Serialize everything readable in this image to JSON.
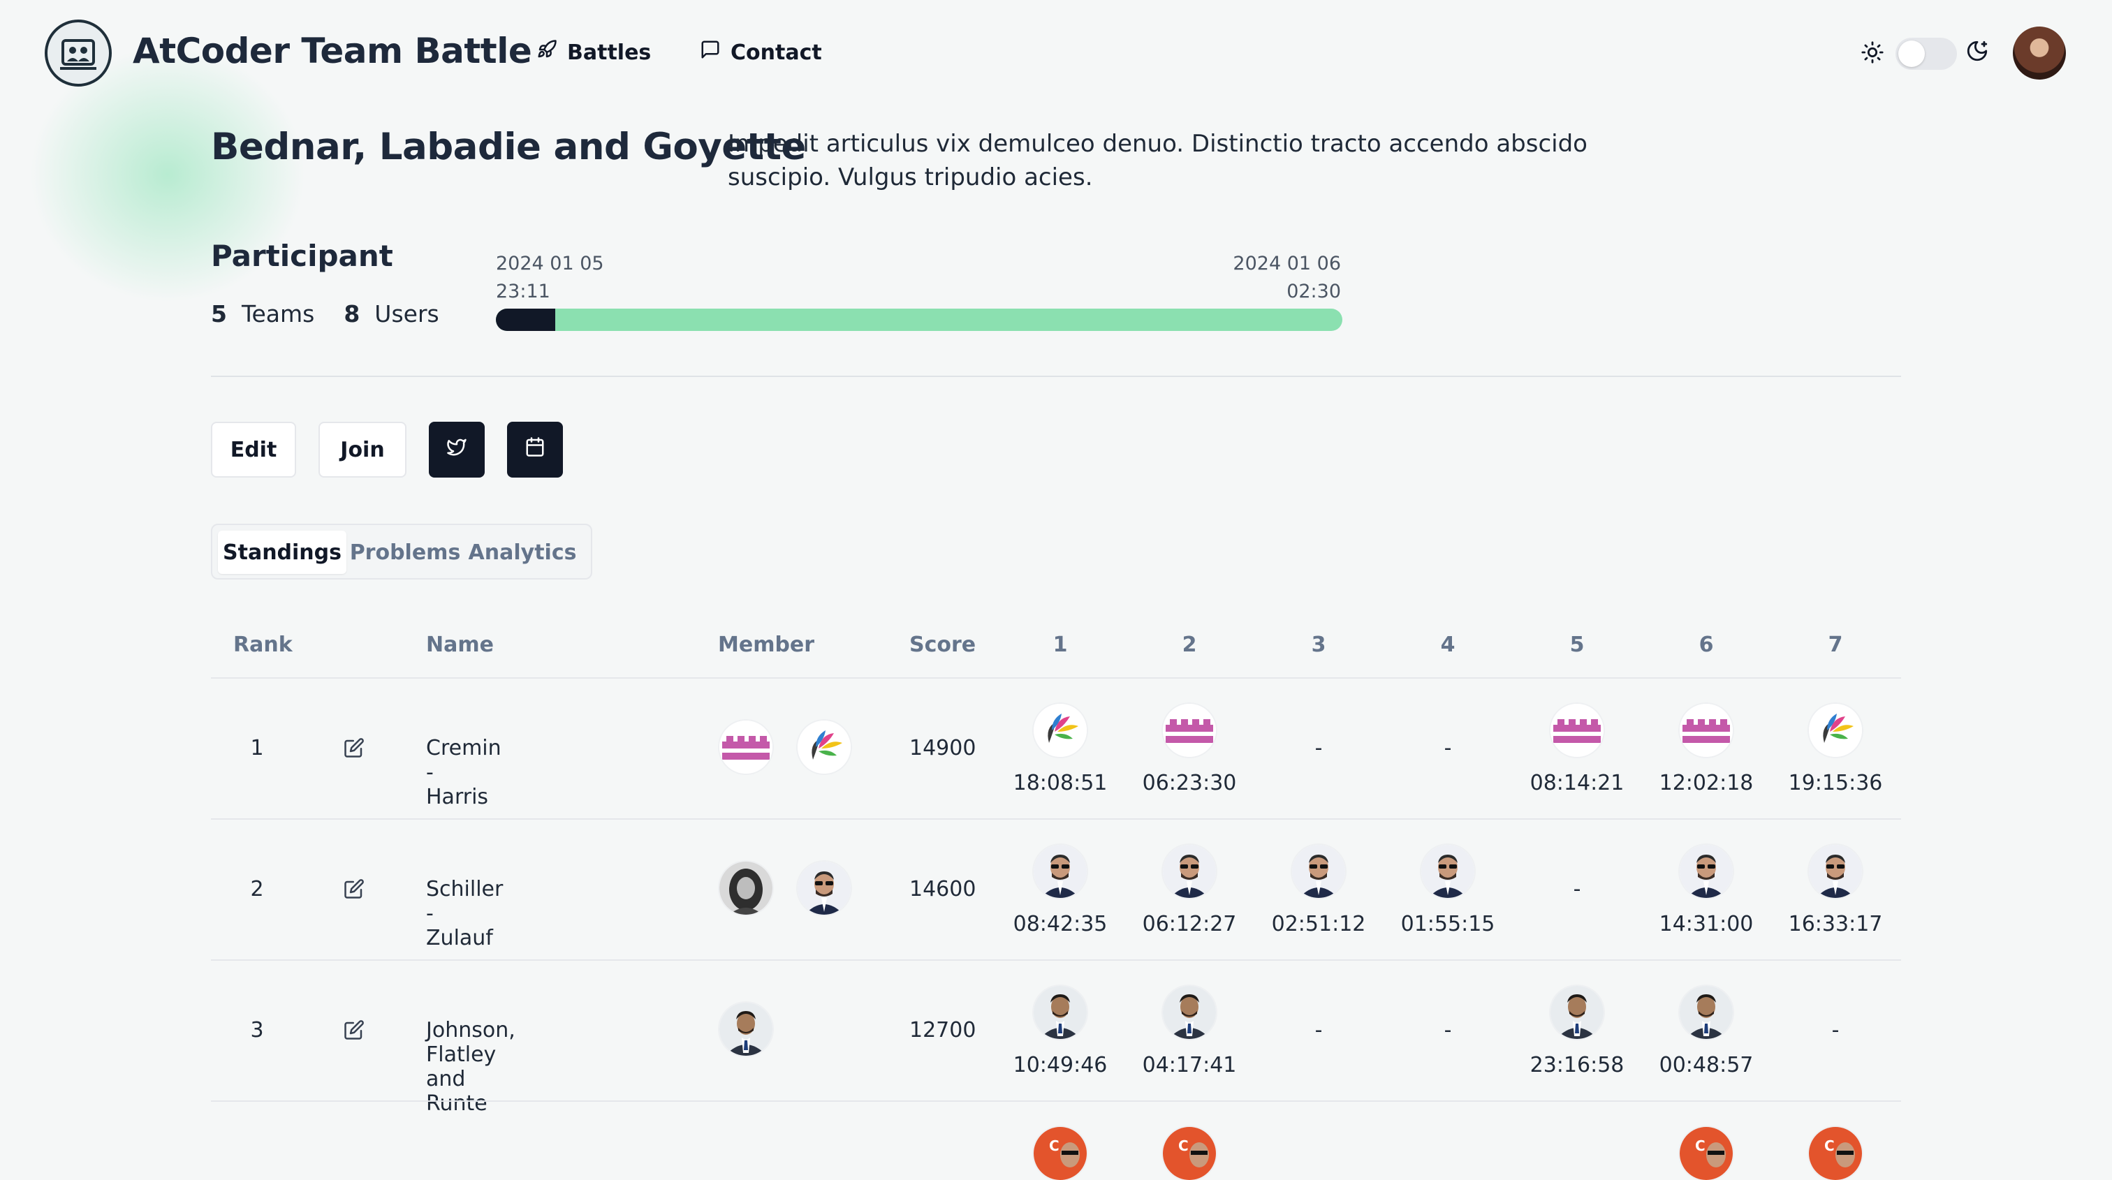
{
  "header": {
    "brand": "AtCoder Team Battle",
    "nav": [
      {
        "label": "Battles",
        "icon": "rocket-icon"
      },
      {
        "label": "Contact",
        "icon": "message-icon"
      }
    ]
  },
  "battle": {
    "title": "Bednar, Labadie and Goyette",
    "description": "Impedit articulus vix demulceo denuo. Distinctio tracto accendo abscido suscipio. Vulgus tripudio acies."
  },
  "participant": {
    "title": "Participant",
    "teams_count": "5",
    "teams_label": "Teams",
    "users_count": "8",
    "users_label": "Users"
  },
  "timeline": {
    "start_date": "2024 01 05",
    "start_time": "23:11",
    "end_date": "2024 01 06",
    "end_time": "02:30",
    "elapsed_fraction": 0.07
  },
  "actions": {
    "edit_label": "Edit",
    "join_label": "Join"
  },
  "tabs": [
    "Standings",
    "Problems",
    "Analytics"
  ],
  "table": {
    "headers": [
      "Rank",
      "Name",
      "Member",
      "Score",
      "1",
      "2",
      "3",
      "4",
      "5",
      "6",
      "7"
    ],
    "rows": [
      {
        "rank": "1",
        "name": "Cremin - Harris",
        "score": "14900",
        "members": [
          "pixel-avatar",
          "petal-avatar"
        ],
        "problems": [
          {
            "avatar": "petal-avatar",
            "time": "18:08:51"
          },
          {
            "avatar": "pixel-avatar",
            "time": "06:23:30"
          },
          {
            "avatar": null,
            "time": "-"
          },
          {
            "avatar": null,
            "time": "-"
          },
          {
            "avatar": "pixel-avatar",
            "time": "08:14:21"
          },
          {
            "avatar": "pixel-avatar",
            "time": "12:02:18"
          },
          {
            "avatar": "petal-avatar",
            "time": "19:15:36"
          }
        ]
      },
      {
        "rank": "2",
        "name": "Schiller - Zulauf",
        "score": "14600",
        "members": [
          "woman-avatar",
          "sunglasses-man-avatar"
        ],
        "problems": [
          {
            "avatar": "sunglasses-man-avatar",
            "time": "08:42:35"
          },
          {
            "avatar": "sunglasses-man-avatar",
            "time": "06:12:27"
          },
          {
            "avatar": "sunglasses-man-avatar",
            "time": "02:51:12"
          },
          {
            "avatar": "sunglasses-man-avatar",
            "time": "01:55:15"
          },
          {
            "avatar": null,
            "time": "-"
          },
          {
            "avatar": "sunglasses-man-avatar",
            "time": "14:31:00"
          },
          {
            "avatar": "sunglasses-man-avatar",
            "time": "16:33:17"
          }
        ]
      },
      {
        "rank": "3",
        "name": "Johnson, Flatley and Runte",
        "score": "12700",
        "members": [
          "suit-man-avatar"
        ],
        "problems": [
          {
            "avatar": "suit-man-avatar",
            "time": "10:49:46"
          },
          {
            "avatar": "suit-man-avatar",
            "time": "04:17:41"
          },
          {
            "avatar": null,
            "time": "-"
          },
          {
            "avatar": null,
            "time": "-"
          },
          {
            "avatar": "suit-man-avatar",
            "time": "23:16:58"
          },
          {
            "avatar": "suit-man-avatar",
            "time": "00:48:57"
          },
          {
            "avatar": null,
            "time": "-"
          }
        ]
      },
      {
        "rank": "",
        "name": "",
        "score": "",
        "members": [],
        "problems": [
          {
            "avatar": "orange-c-avatar",
            "time": ""
          },
          {
            "avatar": "orange-c-avatar",
            "time": ""
          },
          {
            "avatar": null,
            "time": ""
          },
          {
            "avatar": null,
            "time": ""
          },
          {
            "avatar": null,
            "time": ""
          },
          {
            "avatar": "orange-c-avatar",
            "time": ""
          },
          {
            "avatar": "orange-c-avatar",
            "time": ""
          }
        ]
      }
    ]
  },
  "colors": {
    "accent_green": "#8be0b0",
    "dark": "#111827",
    "muted": "#64748b"
  }
}
